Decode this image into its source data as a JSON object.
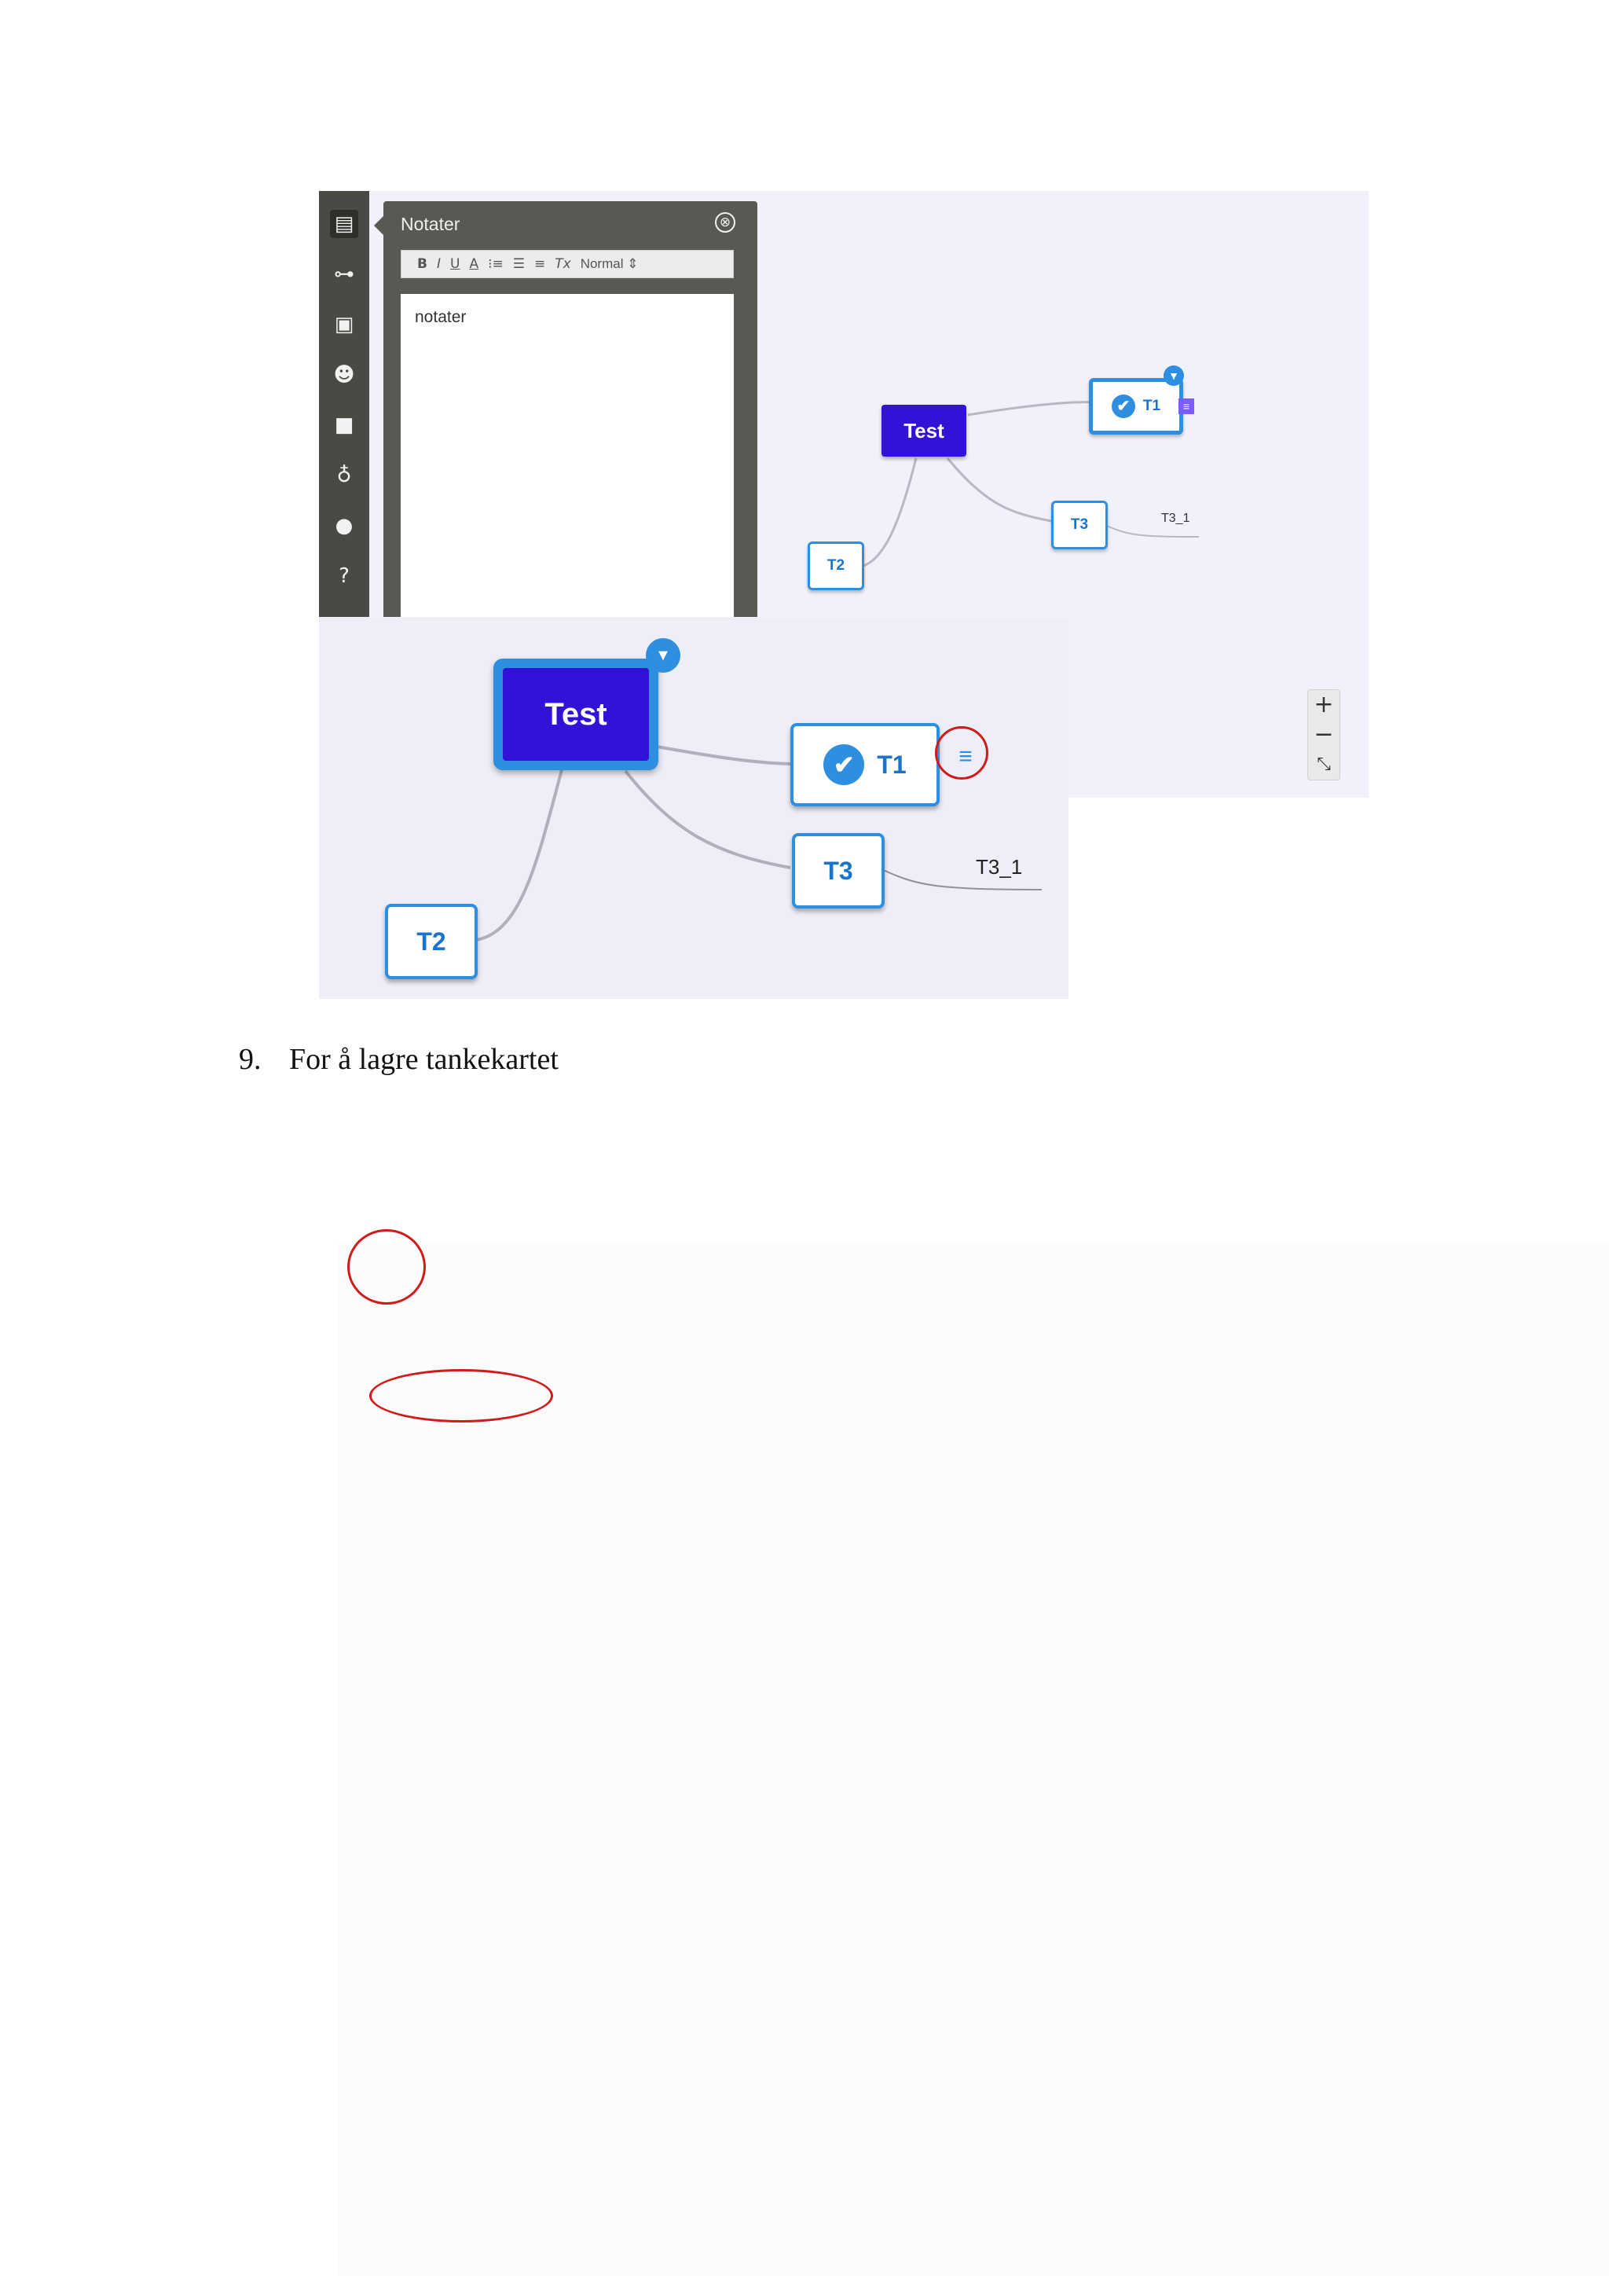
{
  "toolbar_rail": {
    "icons": [
      "notes-icon",
      "link-icon",
      "image-icon",
      "emoji-icon",
      "video-icon",
      "microphone-icon",
      "lightbulb-icon",
      "help-icon"
    ]
  },
  "notes_panel": {
    "title": "Notater",
    "close_glyph": "⊗",
    "format_buttons": [
      "B",
      "I",
      "U",
      "A",
      "⁝≡",
      "☰",
      "≡",
      "Tx"
    ],
    "font_size_select": "Normal",
    "body_text": "notater"
  },
  "mindmap": {
    "root": "Test",
    "children": [
      "T1",
      "T2",
      "T3"
    ],
    "grandchild": "T3_1"
  },
  "zoom_controls": {
    "zoom_in": "+",
    "zoom_out": "−",
    "fit": "⤡"
  },
  "document": {
    "list_number": "9.",
    "list_text": "For å lagre tankekartet"
  },
  "colors": {
    "root_fill": "#3312d8",
    "node_border": "#2e8ee0",
    "node_text": "#1a74c9",
    "annotation": "#d11a1a",
    "panel_bg": "#5a5852"
  }
}
